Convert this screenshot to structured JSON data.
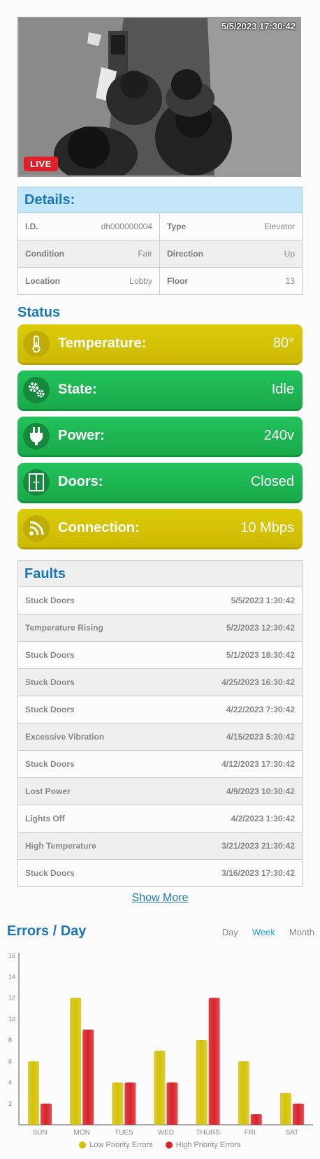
{
  "camera": {
    "timestamp": "5/5/2023 17:30:42",
    "live_label": "LIVE"
  },
  "details": {
    "title": "Details:",
    "rows": [
      [
        {
          "label": "I.D.",
          "value": "dh000000004"
        },
        {
          "label": "Type",
          "value": "Elevator"
        }
      ],
      [
        {
          "label": "Condition",
          "value": "Fair"
        },
        {
          "label": "Direction",
          "value": "Up"
        }
      ],
      [
        {
          "label": "Location",
          "value": "Lobby"
        },
        {
          "label": "Floor",
          "value": "13"
        }
      ]
    ]
  },
  "status": {
    "title": "Status",
    "items": [
      {
        "label": "Temperature:",
        "value": "80°",
        "color": "yellow",
        "icon": "thermometer-icon"
      },
      {
        "label": "State:",
        "value": "Idle",
        "color": "green",
        "icon": "gears-icon"
      },
      {
        "label": "Power:",
        "value": "240v",
        "color": "green",
        "icon": "plug-icon"
      },
      {
        "label": "Doors:",
        "value": "Closed",
        "color": "green",
        "icon": "elevator-doors-icon"
      },
      {
        "label": "Connection:",
        "value": "10 Mbps",
        "color": "yellow",
        "icon": "signal-icon"
      }
    ],
    "colors": {
      "yellow": "#d4c208",
      "green": "#1fb552"
    }
  },
  "faults": {
    "title": "Faults",
    "items": [
      {
        "name": "Stuck Doors",
        "time": "5/5/2023 1:30:42"
      },
      {
        "name": "Temperature Rising",
        "time": "5/2/2023 12:30:42"
      },
      {
        "name": "Stuck Doors",
        "time": "5/1/2023 18:30:42"
      },
      {
        "name": "Stuck Doors",
        "time": "4/25/2023 16:30:42"
      },
      {
        "name": "Stuck Doors",
        "time": "4/22/2023 7:30:42"
      },
      {
        "name": "Excessive Vibration",
        "time": "4/15/2023 5:30:42"
      },
      {
        "name": "Stuck Doors",
        "time": "4/12/2023 17:30:42"
      },
      {
        "name": "Lost Power",
        "time": "4/9/2023 10:30:42"
      },
      {
        "name": "Lights Off",
        "time": "4/2/2023 1:30:42"
      },
      {
        "name": "High Temperature",
        "time": "3/21/2023 21:30:42"
      },
      {
        "name": "Stuck Doors",
        "time": "3/16/2023 17:30:42"
      }
    ],
    "show_more": "Show More"
  },
  "errors_chart": {
    "title": "Errors / Day",
    "tabs": [
      {
        "label": "Day",
        "active": false
      },
      {
        "label": "Week",
        "active": true
      },
      {
        "label": "Month",
        "active": false
      }
    ]
  },
  "chart_data": {
    "type": "bar",
    "title": "Errors / Day",
    "categories": [
      "SUN",
      "MON",
      "TUES",
      "WED",
      "THURS",
      "FRI",
      "SAT"
    ],
    "series": [
      {
        "name": "Low Priority Errors",
        "color": "#d4c208",
        "values": [
          6,
          12,
          4,
          7,
          8,
          6,
          3
        ]
      },
      {
        "name": "High Priority Errors",
        "color": "#d8232a",
        "values": [
          2,
          9,
          4,
          4,
          12,
          1,
          2
        ]
      }
    ],
    "yticks": [
      2,
      4,
      6,
      8,
      10,
      12,
      14,
      16
    ],
    "ylim": [
      0,
      16
    ],
    "grid": false,
    "legend": "bottom"
  }
}
